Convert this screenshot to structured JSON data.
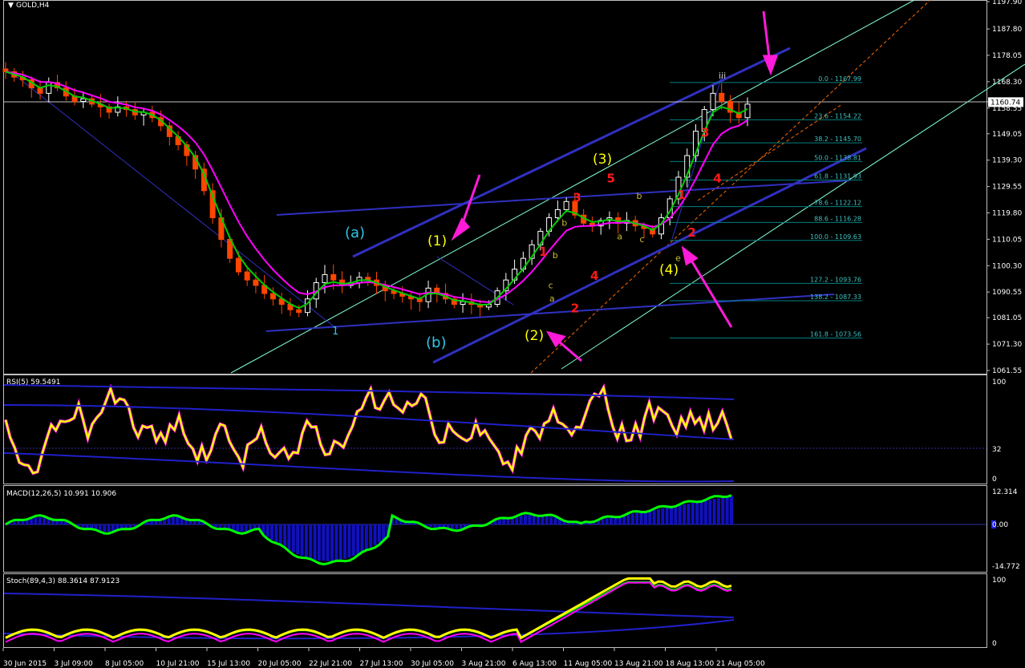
{
  "symbol_title": "GOLD,H4",
  "colors": {
    "background": "#000000",
    "grid_border": "#c0c0c0",
    "candle_up": "#ffffff",
    "candle_down": "#ff4500",
    "ma_fast": "#00cc00",
    "ma_slow": "#ff00ff",
    "trendline": "#2020c8",
    "channel": "#7fffd4",
    "fib": "#008080",
    "fib_text": "#40c0c0",
    "arrow": "#ff1bd8",
    "wave_cyan": "#2ec7e6",
    "wave_yellow": "#ffff00",
    "wave_red": "#ff1a1a",
    "wave_small": "#c8b830",
    "rsi_line": "#ffff00",
    "macd_hist": "#1010c0",
    "macd_line": "#00ff00",
    "stoch_main": "#ffff00"
  },
  "price_axis": {
    "ticks": [
      "1197.90",
      "1187.80",
      "1178.05",
      "1168.30",
      "1158.55",
      "1149.05",
      "1139.30",
      "1129.55",
      "1119.80",
      "1110.05",
      "1100.30",
      "1090.55",
      "1081.05",
      "1071.30",
      "1061.55"
    ],
    "current_price": "1160.74"
  },
  "time_axis": [
    "30 Jun 2015",
    "3 Jul 09:00",
    "8 Jul 05:00",
    "10 Jul 21:00",
    "15 Jul 13:00",
    "20 Jul 05:00",
    "22 Jul 21:00",
    "27 Jul 13:00",
    "30 Jul 05:00",
    "3 Aug 21:00",
    "6 Aug 13:00",
    "11 Aug 05:00",
    "13 Aug 21:00",
    "18 Aug 13:00",
    "21 Aug 05:00"
  ],
  "fib_levels": [
    {
      "label": "0.0 - 1167.99",
      "price": 1167.99
    },
    {
      "label": "23.6 - 1154.22",
      "price": 1154.22
    },
    {
      "label": "38.2 - 1145.70",
      "price": 1145.7
    },
    {
      "label": "50.0 - 1138.81",
      "price": 1138.81
    },
    {
      "label": "61.8 - 1131.93",
      "price": 1131.93
    },
    {
      "label": "78.6 - 1122.12",
      "price": 1122.12
    },
    {
      "label": "88.6 - 1116.28",
      "price": 1116.28
    },
    {
      "label": "100.0 - 1109.63",
      "price": 1109.63
    },
    {
      "label": "127.2 - 1093.76",
      "price": 1093.76
    },
    {
      "label": "138.2 - 1087.33",
      "price": 1087.33
    },
    {
      "label": "161.8 - 1073.56",
      "price": 1073.56
    }
  ],
  "wave_labels": {
    "a_paren": "(a)",
    "b_paren": "(b)",
    "w1": "(1)",
    "w2": "(2)",
    "w3": "(3)",
    "w4": "(4)",
    "one_blue": "1",
    "iii": "iii"
  },
  "red_labels": [
    {
      "text": "1",
      "price": 1104,
      "t": 0.522
    },
    {
      "text": "2",
      "price": 1083,
      "t": 0.553
    },
    {
      "text": "3",
      "price": 1124,
      "t": 0.555
    },
    {
      "text": "4",
      "price": 1095,
      "t": 0.572
    },
    {
      "text": "5",
      "price": 1131,
      "t": 0.588
    },
    {
      "text": "1",
      "price": 1125,
      "t": 0.657
    },
    {
      "text": "2",
      "price": 1111,
      "t": 0.667
    },
    {
      "text": "3",
      "price": 1148,
      "t": 0.68
    },
    {
      "text": "4",
      "price": 1131,
      "t": 0.692
    }
  ],
  "small_labels": [
    {
      "text": "a",
      "price": 1087,
      "t": 0.532
    },
    {
      "text": "b",
      "price": 1103,
      "t": 0.535
    },
    {
      "text": "c",
      "price": 1092,
      "t": 0.531
    },
    {
      "text": "b",
      "price": 1115,
      "t": 0.544
    },
    {
      "text": "a",
      "price": 1110,
      "t": 0.598
    },
    {
      "text": "b",
      "price": 1125,
      "t": 0.617
    },
    {
      "text": "c",
      "price": 1109,
      "t": 0.62
    },
    {
      "text": "e",
      "price": 1102,
      "t": 0.655
    }
  ],
  "rsi": {
    "title": "RSI(5) 59.5491",
    "axis": [
      "100",
      "32",
      "0"
    ]
  },
  "macd": {
    "title": "MACD(12,26,5) 10.991 10.906",
    "axis": [
      "12.314",
      "0.00",
      "-14.772"
    ]
  },
  "stoch": {
    "title": "Stoch(89,4,3) 88.3614 87.9123",
    "axis": [
      "100",
      "0"
    ]
  },
  "chart_data": {
    "type": "candlestick",
    "title": "GOLD,H4",
    "ylim": [
      1061.55,
      1197.9
    ],
    "closes": [
      1172,
      1170,
      1169,
      1166,
      1164,
      1168,
      1166,
      1163,
      1161,
      1162,
      1160,
      1159,
      1157,
      1159,
      1158,
      1156,
      1157,
      1155,
      1152,
      1148,
      1145,
      1141,
      1136,
      1128,
      1118,
      1110,
      1103,
      1098,
      1095,
      1093,
      1090,
      1088,
      1086,
      1084,
      1083,
      1088,
      1094,
      1097,
      1095,
      1093,
      1094,
      1096,
      1095,
      1093,
      1091,
      1090,
      1089,
      1088,
      1087,
      1092,
      1090,
      1088,
      1086,
      1087,
      1086,
      1085,
      1086,
      1091,
      1095,
      1099,
      1103,
      1108,
      1113,
      1118,
      1121,
      1124,
      1119,
      1116,
      1115,
      1117,
      1118,
      1116,
      1117,
      1115,
      1114,
      1112,
      1118,
      1125,
      1133,
      1141,
      1150,
      1158,
      1164,
      1161,
      1157,
      1155,
      1160
    ]
  }
}
